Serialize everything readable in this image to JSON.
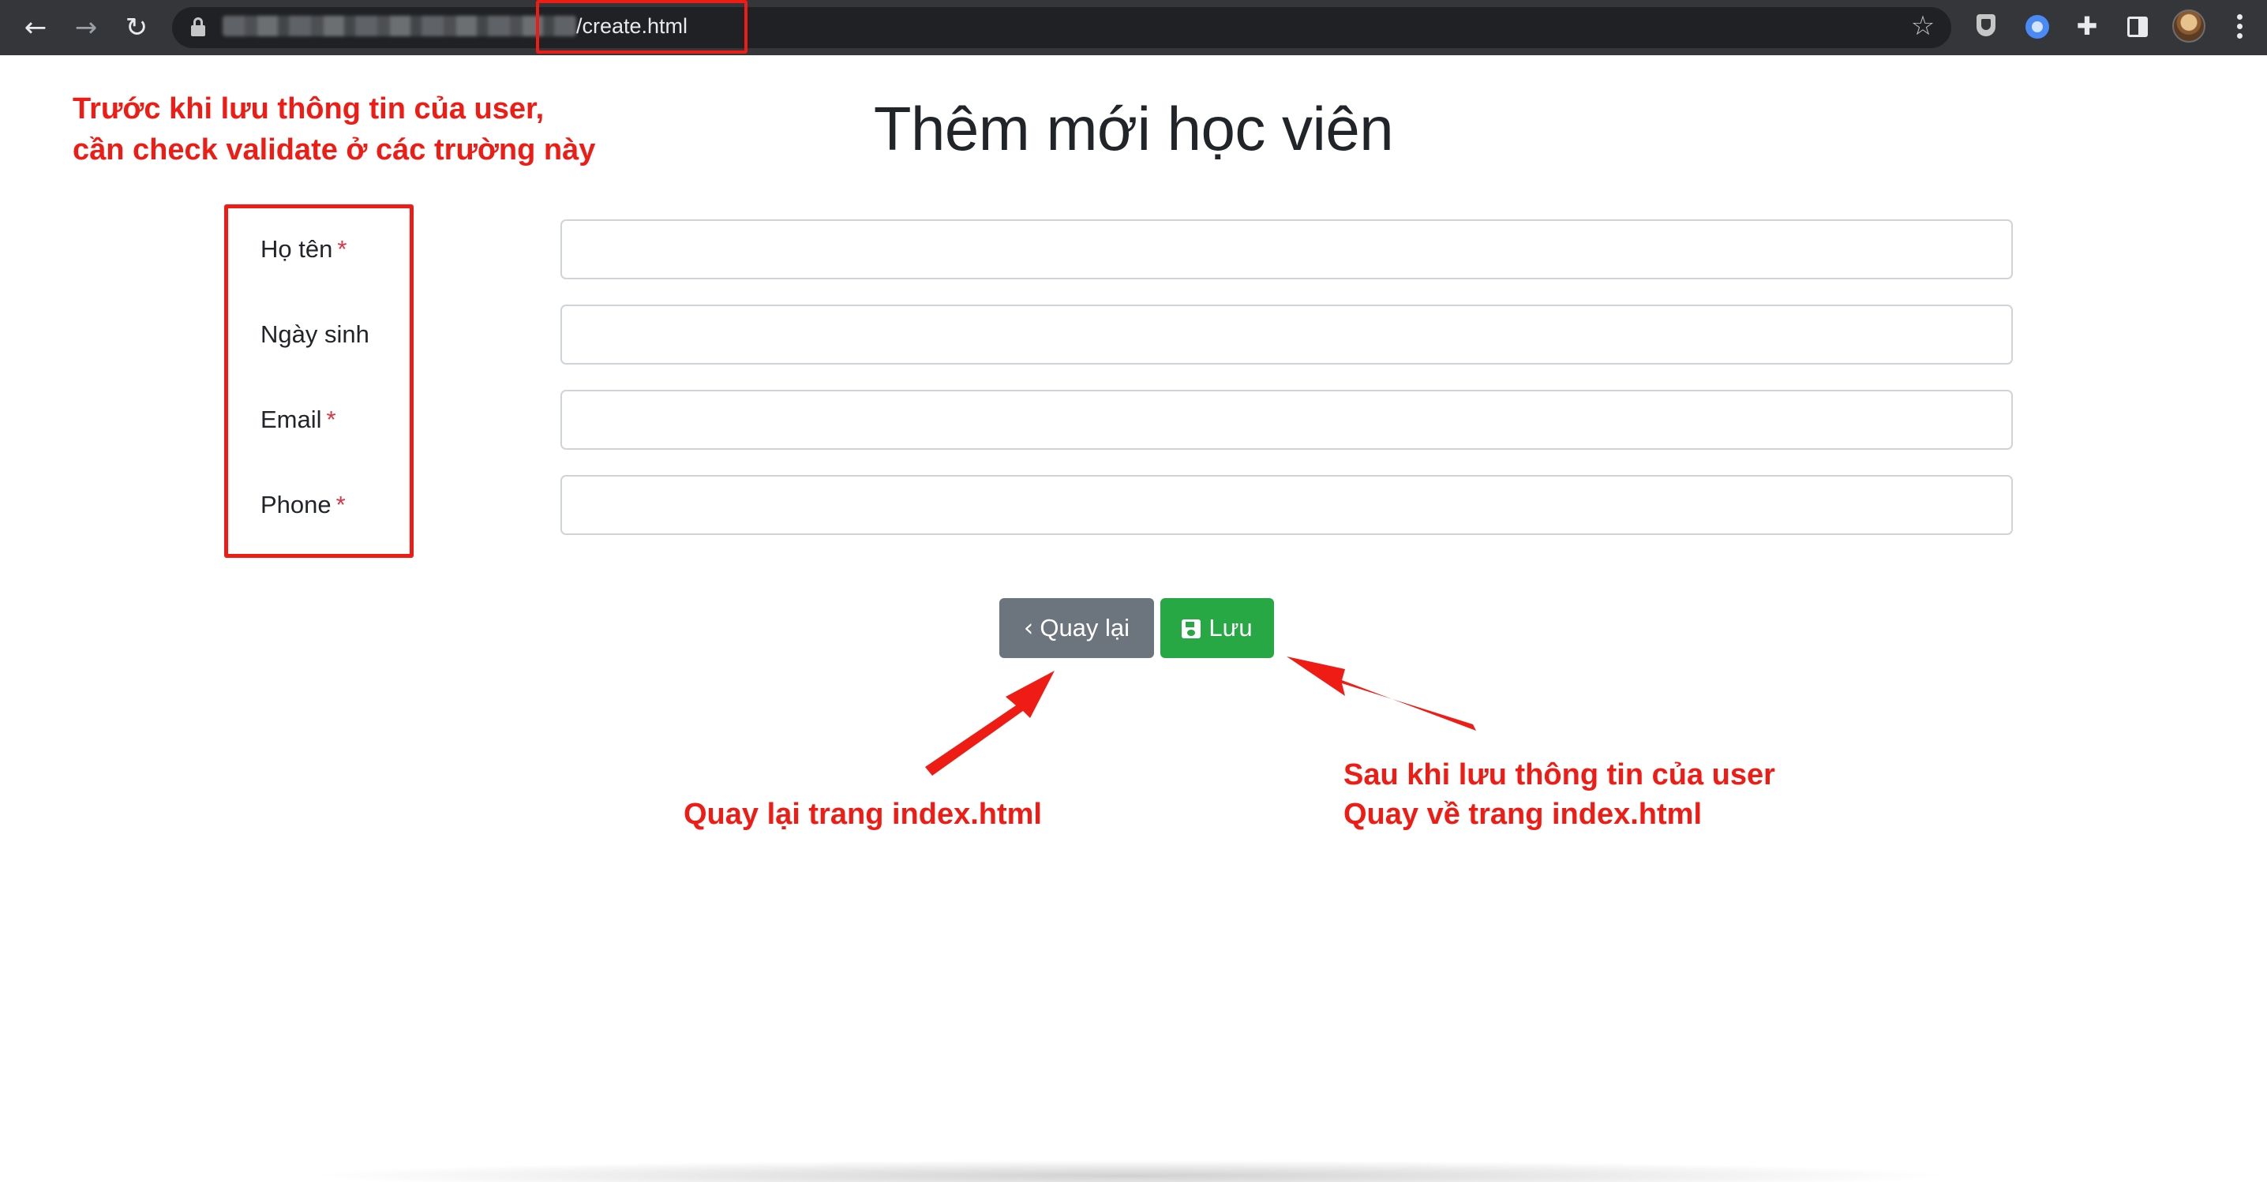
{
  "browser": {
    "back_icon": "arrow-left-icon",
    "forward_icon": "arrow-right-icon",
    "reload_icon": "reload-icon",
    "url_path": "/create.html",
    "star_icon": "star-icon",
    "extension_icons": [
      "shield-icon",
      "circle-extension-icon",
      "puzzle-icon",
      "side-panel-icon"
    ],
    "avatar": "avatar"
  },
  "page": {
    "title": "Thêm mới học viên",
    "fields": [
      {
        "label": "Họ tên",
        "required": "*",
        "value": ""
      },
      {
        "label": "Ngày sinh",
        "required": "",
        "value": ""
      },
      {
        "label": "Email",
        "required": "*",
        "value": ""
      },
      {
        "label": "Phone",
        "required": "*",
        "value": ""
      }
    ],
    "buttons": {
      "back_label": "Quay lại",
      "save_label": "Lưu"
    }
  },
  "annotations": {
    "top_left_line1": "Trước khi lưu thông tin của user,",
    "top_left_line2": "cần check validate ở các trường này",
    "back_note": "Quay lại trang index.html",
    "save_note_line1": "Sau khi lưu thông tin của user",
    "save_note_line2": "Quay về trang index.html"
  },
  "colors": {
    "annotation_red": "#ee1c14",
    "back_button": "#6c757d",
    "save_button": "#28a745",
    "required_star": "#dc3545",
    "toolbar": "#35363a"
  }
}
